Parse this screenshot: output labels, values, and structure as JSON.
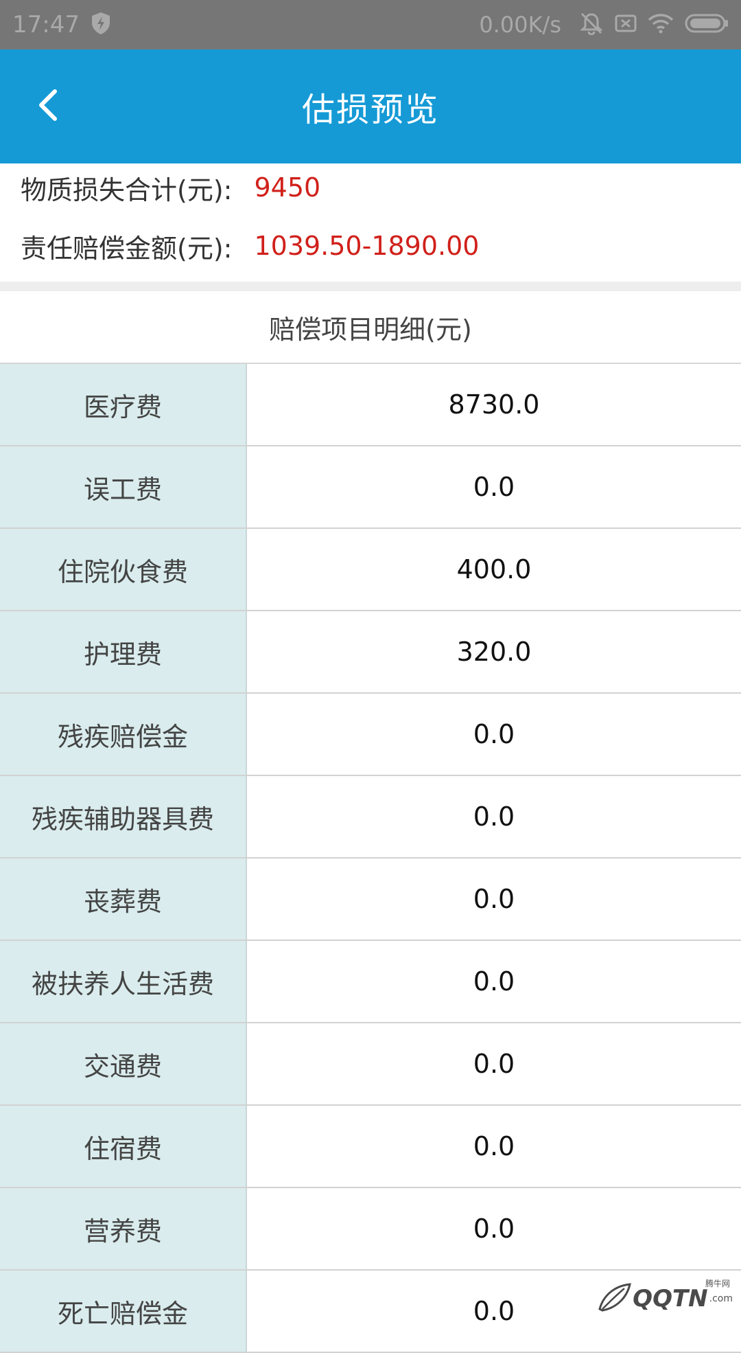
{
  "status_bar": {
    "time": "17:47",
    "speed": "0.00K/s",
    "icons": [
      "shield-bolt-icon",
      "mute-bell-icon",
      "sim-card-x-icon",
      "wifi-icon",
      "battery-icon"
    ]
  },
  "app_bar": {
    "title": "估损预览",
    "back_icon": "chevron-left-icon",
    "color": "#159ad6"
  },
  "summary": {
    "material_loss_label": "物质损失合计(元):",
    "material_loss_value": "9450",
    "liability_label": "责任赔偿金额(元):",
    "liability_value": "1039.50-1890.00",
    "value_color": "#d0201a"
  },
  "section": {
    "title": "赔偿项目明细(元)"
  },
  "items": [
    {
      "label": "医疗费",
      "value": "8730.0"
    },
    {
      "label": "误工费",
      "value": "0.0"
    },
    {
      "label": "住院伙食费",
      "value": "400.0"
    },
    {
      "label": "护理费",
      "value": "320.0"
    },
    {
      "label": "残疾赔偿金",
      "value": "0.0"
    },
    {
      "label": "残疾辅助器具费",
      "value": "0.0"
    },
    {
      "label": "丧葬费",
      "value": "0.0"
    },
    {
      "label": "被扶养人生活费",
      "value": "0.0"
    },
    {
      "label": "交通费",
      "value": "0.0"
    },
    {
      "label": "住宿费",
      "value": "0.0"
    },
    {
      "label": "营养费",
      "value": "0.0"
    },
    {
      "label": "死亡赔偿金",
      "value": "0.0"
    }
  ],
  "watermark": {
    "text": "QQTN",
    "small": ".com",
    "logo_text": "腾牛网"
  }
}
